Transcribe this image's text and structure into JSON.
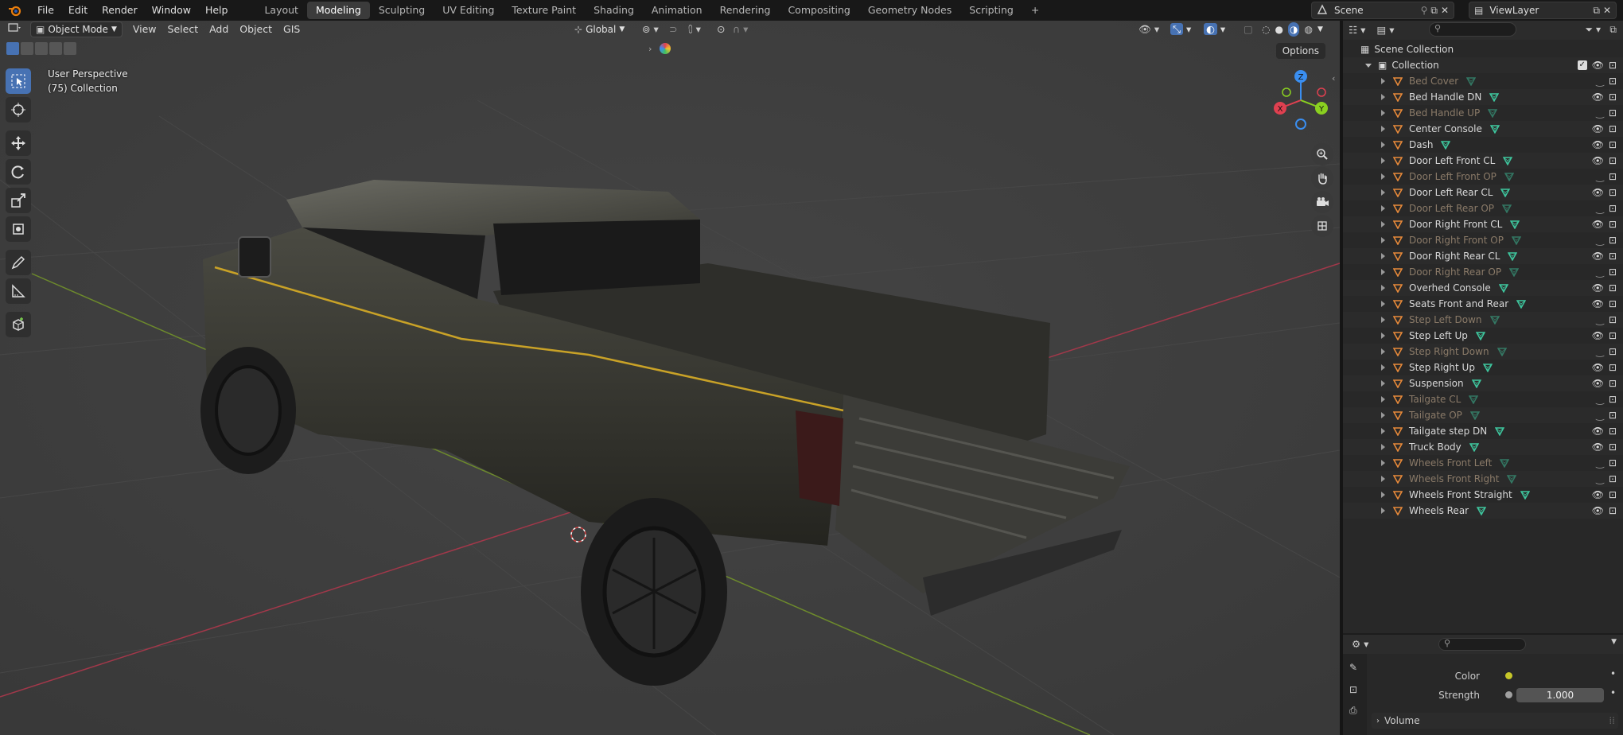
{
  "menu": {
    "items": [
      "File",
      "Edit",
      "Render",
      "Window",
      "Help"
    ]
  },
  "workspaces": [
    "Layout",
    "Modeling",
    "Sculpting",
    "UV Editing",
    "Texture Paint",
    "Shading",
    "Animation",
    "Rendering",
    "Compositing",
    "Geometry Nodes",
    "Scripting"
  ],
  "active_workspace": "Modeling",
  "scene": {
    "name": "Scene"
  },
  "view_layer": {
    "name": "ViewLayer"
  },
  "viewport": {
    "mode": "Object Mode",
    "menus": [
      "View",
      "Select",
      "Add",
      "Object",
      "GIS"
    ],
    "transform_orientation": "Global",
    "perspective": "User Perspective",
    "collection_info": "(75) Collection",
    "options_label": "Options",
    "axis": {
      "x": "X",
      "y": "Y",
      "z": "Z"
    }
  },
  "outliner": {
    "root": "Scene Collection",
    "collection": "Collection",
    "objects": [
      {
        "name": "Bed Cover",
        "visible": false
      },
      {
        "name": "Bed Handle DN",
        "visible": true
      },
      {
        "name": "Bed Handle UP",
        "visible": false
      },
      {
        "name": "Center Console",
        "visible": true
      },
      {
        "name": "Dash",
        "visible": true
      },
      {
        "name": "Door Left Front CL",
        "visible": true
      },
      {
        "name": "Door Left Front OP",
        "visible": false
      },
      {
        "name": "Door Left Rear CL",
        "visible": true
      },
      {
        "name": "Door Left Rear OP",
        "visible": false
      },
      {
        "name": "Door Right Front CL",
        "visible": true
      },
      {
        "name": "Door Right Front OP",
        "visible": false
      },
      {
        "name": "Door Right Rear CL",
        "visible": true
      },
      {
        "name": "Door Right Rear OP",
        "visible": false
      },
      {
        "name": "Overhed Console",
        "visible": true
      },
      {
        "name": "Seats Front and Rear",
        "visible": true
      },
      {
        "name": "Step Left Down",
        "visible": false
      },
      {
        "name": "Step Left Up",
        "visible": true
      },
      {
        "name": "Step Right Down",
        "visible": false
      },
      {
        "name": "Step Right Up",
        "visible": true
      },
      {
        "name": "Suspension",
        "visible": true
      },
      {
        "name": "Tailgate CL",
        "visible": false
      },
      {
        "name": "Tailgate OP",
        "visible": false
      },
      {
        "name": "Tailgate step DN",
        "visible": true
      },
      {
        "name": "Truck Body",
        "visible": true
      },
      {
        "name": "Wheels Front Left",
        "visible": false
      },
      {
        "name": "Wheels Front Right",
        "visible": false
      },
      {
        "name": "Wheels Front Straight",
        "visible": true
      },
      {
        "name": "Wheels Rear",
        "visible": true
      }
    ]
  },
  "properties": {
    "color_label": "Color",
    "strength_label": "Strength",
    "strength_value": "1.000",
    "volume_label": "Volume"
  },
  "colors": {
    "accent": "#4772b3",
    "mesh_icon": "#e88a3a",
    "data_icon": "#3fc9a0",
    "axis_x": "#e04050",
    "axis_y": "#8ad020",
    "axis_z": "#3a8ef0"
  }
}
